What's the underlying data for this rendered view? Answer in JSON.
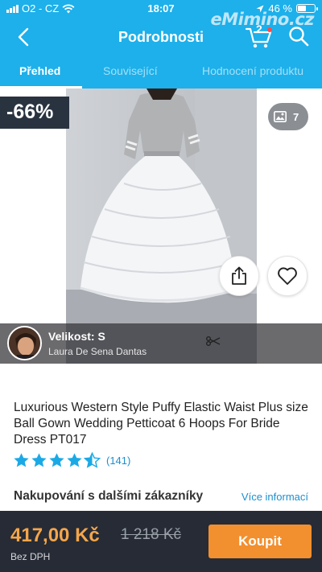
{
  "status_bar": {
    "carrier": "O2 - CZ",
    "time": "18:07",
    "battery": "46 %",
    "watermark": "eMimino.cz"
  },
  "header": {
    "title": "Podrobnosti",
    "cart_count": "2",
    "back_icon": "back-arrow-icon",
    "cart_icon": "cart-icon",
    "search_icon": "search-icon"
  },
  "tabs": [
    {
      "label": "Přehled",
      "active": true
    },
    {
      "label": "Související",
      "active": false
    },
    {
      "label": "Hodnocení produktu",
      "active": false
    }
  ],
  "gallery": {
    "discount": "-66%",
    "image_count": "7",
    "review_size": "Velikost: S",
    "reviewer_name": "Laura De Sena Dantas"
  },
  "product": {
    "title": "Luxurious Western Style Puffy Elastic Waist Plus size Ball Gown Wedding Petticoat 6 Hoops For Bride Dress PT017",
    "rating": 4.5,
    "rating_count": "(141)"
  },
  "section": {
    "title": "Nakupování s dalšími zákazníky",
    "more_link": "Více informací"
  },
  "purchase": {
    "price": "417,00 Kč",
    "old_price": "1 218 Kč",
    "vat_note": "Bez DPH",
    "buy_label": "Koupit"
  },
  "colors": {
    "brand": "#1db0ea",
    "buy": "#f28f2e",
    "price": "#f5a64a",
    "star": "#1ba9e6"
  }
}
